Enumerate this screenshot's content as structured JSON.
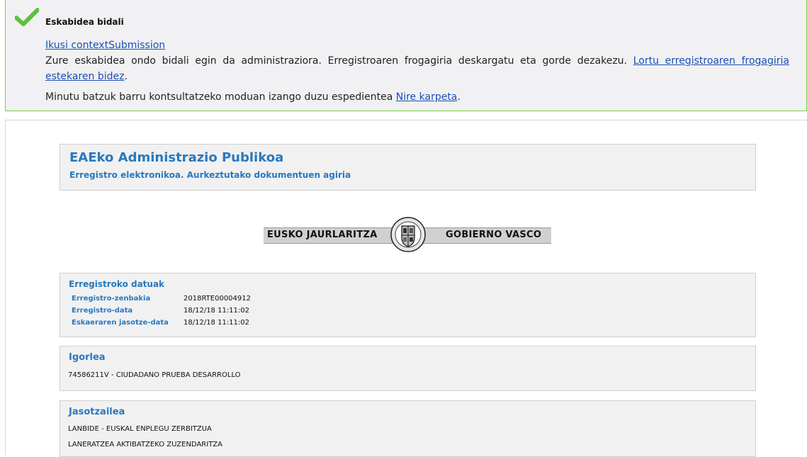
{
  "banner": {
    "title": "Eskabidea bidali",
    "link1": "Ikusi contextSubmission",
    "msg_text": "Zure eskabidea ondo bidali egin da administraziora. Erregistroaren frogagiria deskargatu eta gorde dezakezu. ",
    "msg_link": "Lortu erregistroaren frogagiria estekaren bidez",
    "msg_end": ".",
    "msg2_text": "Minutu batzuk barru kontsultatzeko moduan izango duzu espedientea ",
    "msg2_link": "Nire karpeta",
    "msg2_end": ".",
    "check_icon": "check-icon",
    "accent": "#7ccd4b"
  },
  "document": {
    "title": "EAEko Administrazio Publikoa",
    "subtitle": "Erregistro elektronikoa. Aurkeztutako dokumentuen agiria",
    "logo_left": "EUSKO JAURLARITZA",
    "logo_right": "GOBIERNO VASCO",
    "title_color": "#2978bf"
  },
  "registry": {
    "title": "Erregistroko datuak",
    "rows": [
      {
        "label": "Erregistro-zenbakia",
        "value": "2018RTE00004912"
      },
      {
        "label": "Erregistro-data",
        "value": "18/12/18 11:11:02"
      },
      {
        "label": "Eskaeraren jasotze-data",
        "value": "18/12/18 11:11:02"
      }
    ]
  },
  "sender": {
    "title": "Igorlea",
    "value": "74586211V - CIUDADANO PRUEBA DESARROLLO"
  },
  "receiver": {
    "title": "Jasotzailea",
    "line1": "LANBIDE - EUSKAL ENPLEGU ZERBITZUA",
    "line2": "LANERATZEA AKTIBATZEKO ZUZENDARITZA"
  }
}
